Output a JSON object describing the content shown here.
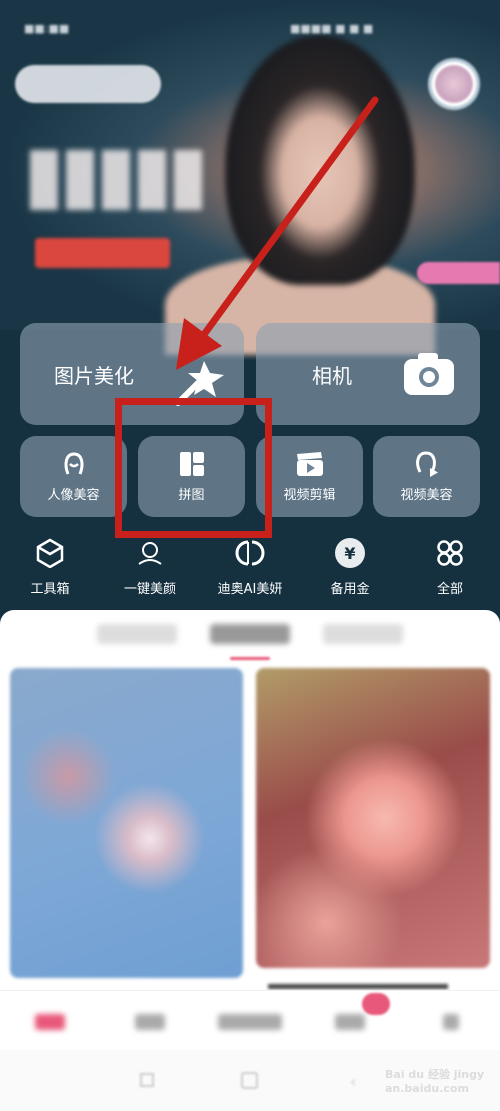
{
  "main_actions": [
    {
      "label": "图片美化",
      "icon": "magic-wand-icon"
    },
    {
      "label": "相机",
      "icon": "camera-icon"
    }
  ],
  "quick_actions": [
    {
      "label": "人像美容",
      "icon": "face-icon"
    },
    {
      "label": "拼图",
      "icon": "collage-icon"
    },
    {
      "label": "视频剪辑",
      "icon": "video-clapper-icon"
    },
    {
      "label": "视频美容",
      "icon": "video-face-icon"
    }
  ],
  "tools": [
    {
      "label": "工具箱",
      "icon": "box-icon"
    },
    {
      "label": "一键美颜",
      "icon": "beauty-icon"
    },
    {
      "label": "迪奥AI美妍",
      "icon": "dior-icon"
    },
    {
      "label": "备用金",
      "icon": "yen-icon",
      "glyph": "¥"
    },
    {
      "label": "全部",
      "icon": "grid-icon"
    }
  ],
  "watermark": "Bai du 经验 jingyan.baidu.com",
  "colors": {
    "background": "#15303f",
    "annotation": "#c8201a",
    "accent": "#e8587a"
  }
}
